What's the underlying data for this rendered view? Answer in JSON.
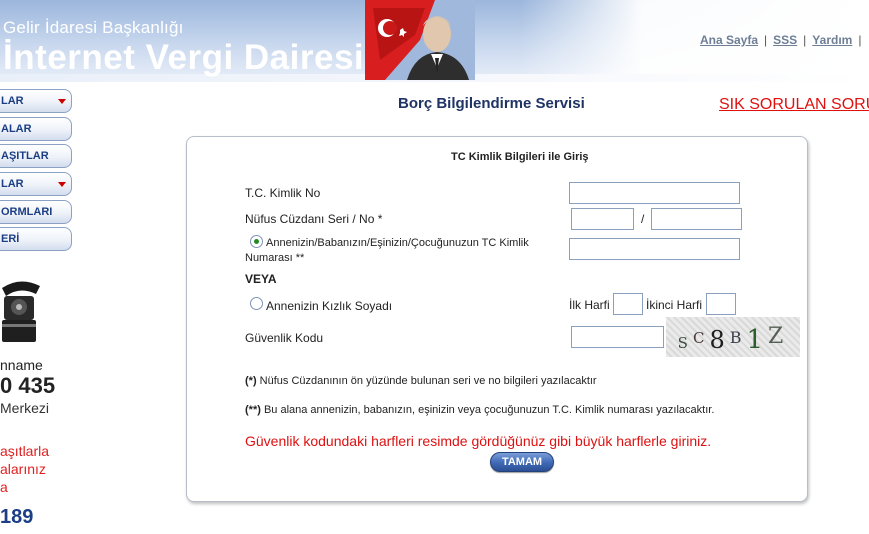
{
  "header": {
    "subtitle": "Gelir İdaresi Başkanlığı",
    "title": "İnternet Vergi Dairesi",
    "links": [
      "Ana Sayfa",
      "SSS",
      "Yardım"
    ]
  },
  "sidebar": {
    "menu": [
      {
        "label": "LAR",
        "has_dropdown": true
      },
      {
        "label": "ALAR",
        "has_dropdown": false
      },
      {
        "label": "AŞITLAR",
        "has_dropdown": false
      },
      {
        "label": "LAR",
        "has_dropdown": true
      },
      {
        "label": "ORMLARI",
        "has_dropdown": false
      },
      {
        "label": "ERİ",
        "has_dropdown": false
      }
    ],
    "contact": {
      "line1": "nname",
      "number": "0 435",
      "line2": "Merkezi",
      "promo": [
        "aşıtlarla",
        "alarınız",
        "a"
      ],
      "short_number": "189"
    }
  },
  "page": {
    "title": "Borç Bilgilendirme Servisi",
    "faq_link": "SIK SORULAN SORULAR"
  },
  "form": {
    "panel_title": "TC Kimlik Bilgileri ile Giriş",
    "tc_label": "T.C. Kimlik No",
    "nufus_label": "Nüfus Cüzdanı Seri / No *",
    "nufus_separator": "/",
    "relative_label_line1": "Annenizin/Babanızın/Eşinizin/Çocuğunuzun TC Kimlik",
    "relative_label_line2": "Numarası **",
    "or_label": "VEYA",
    "maiden_label": "Annenizin Kızlık Soyadı",
    "first_letter_label": "İlk Harfi",
    "second_letter_label": "İkinci Harfi",
    "security_label": "Güvenlik Kodu",
    "captcha_text": "SC8B1Z",
    "note1_marker": "(*)",
    "note1_text": "Nüfus Cüzdanının ön yüzünde bulunan seri ve no bilgileri yazılacaktır",
    "note2_marker": "(**)",
    "note2_text": "Bu alana annenizin, babanızın, eşinizin veya çocuğunuzun T.C. Kimlik numarası yazılacaktır.",
    "warning": "Güvenlik kodundaki harfleri resimde gördüğünüz gibi büyük harflerle giriniz.",
    "submit_label": "TAMAM",
    "relative_option_selected": true,
    "maiden_option_selected": false
  }
}
